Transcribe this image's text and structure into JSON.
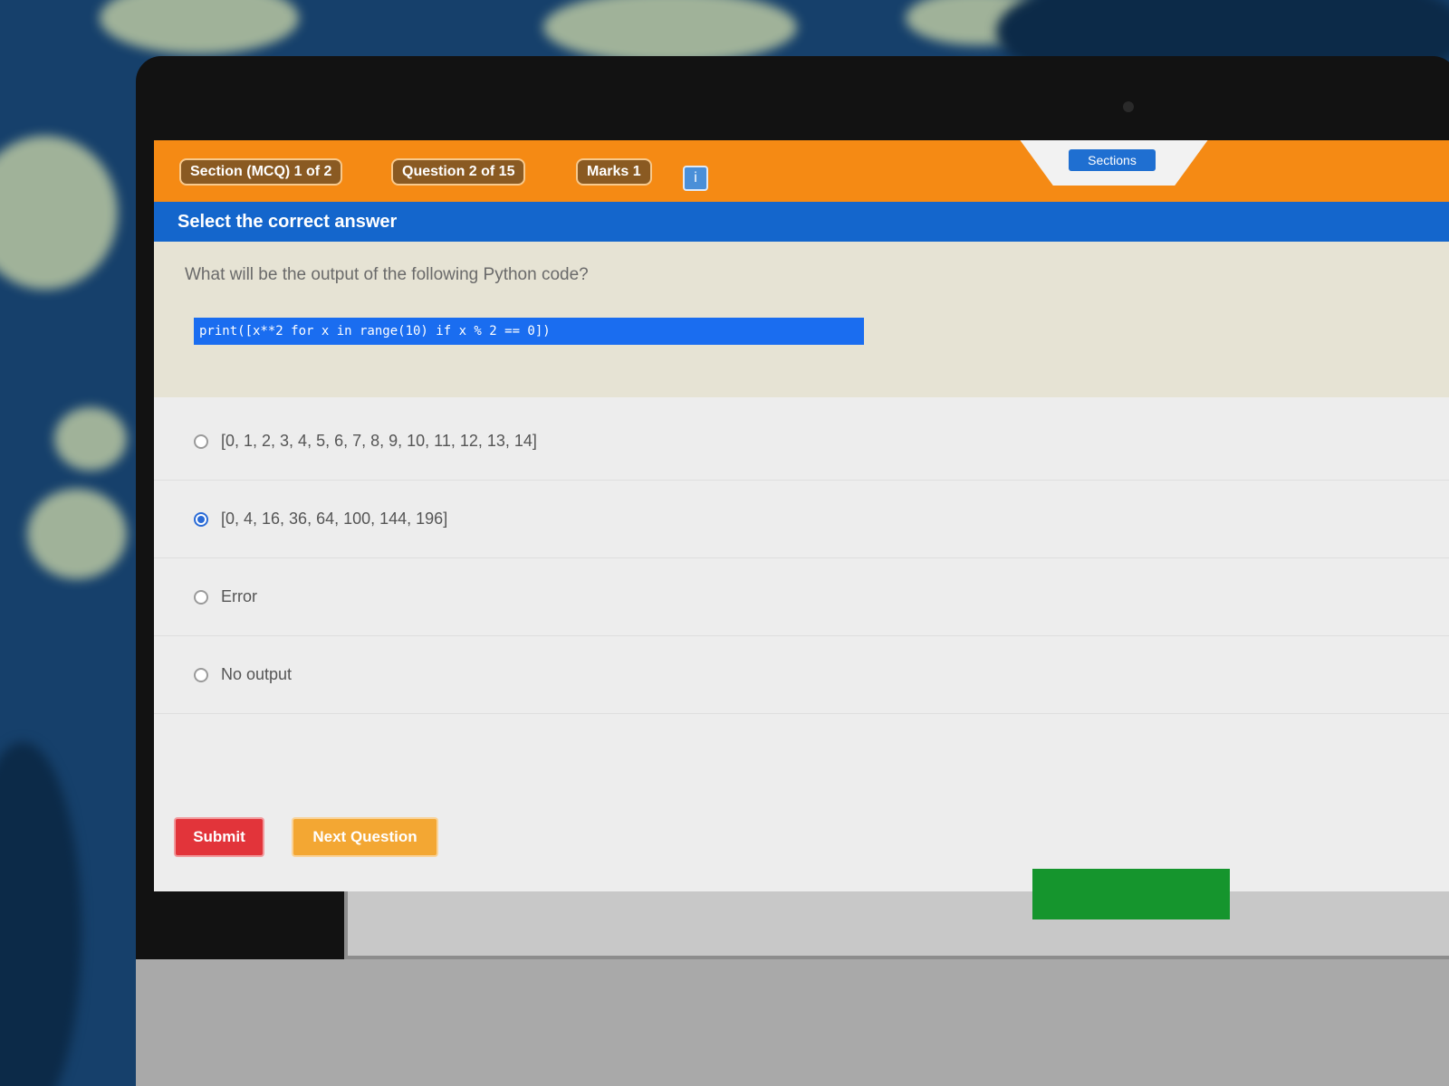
{
  "topbar": {
    "chips": [
      "Section (MCQ) 1 of 2",
      "Question 2 of 15",
      "Marks 1"
    ],
    "icon": "info-icon",
    "tab_label": "Sections"
  },
  "instruction": "Select the correct answer",
  "question": {
    "text": "What will be the output of the following Python code?",
    "code": "print([x**2 for x in range(10) if x % 2 == 0])"
  },
  "options": [
    {
      "label": "[0, 1, 2, 3, 4, 5, 6, 7, 8, 9, 10, 11, 12, 13, 14]",
      "selected": false
    },
    {
      "label": "[0, 4, 16, 36, 64, 100, 144, 196]",
      "selected": true
    },
    {
      "label": "Error",
      "selected": false
    },
    {
      "label": "No output",
      "selected": false
    }
  ],
  "buttons": {
    "red": "Submit",
    "orange": "Next Question"
  },
  "colors": {
    "topbar": "#f58a14",
    "instruction_bar": "#1466cc",
    "question_bg": "#e6e3d4",
    "submit": "#e2343a",
    "next": "#f3a733"
  }
}
